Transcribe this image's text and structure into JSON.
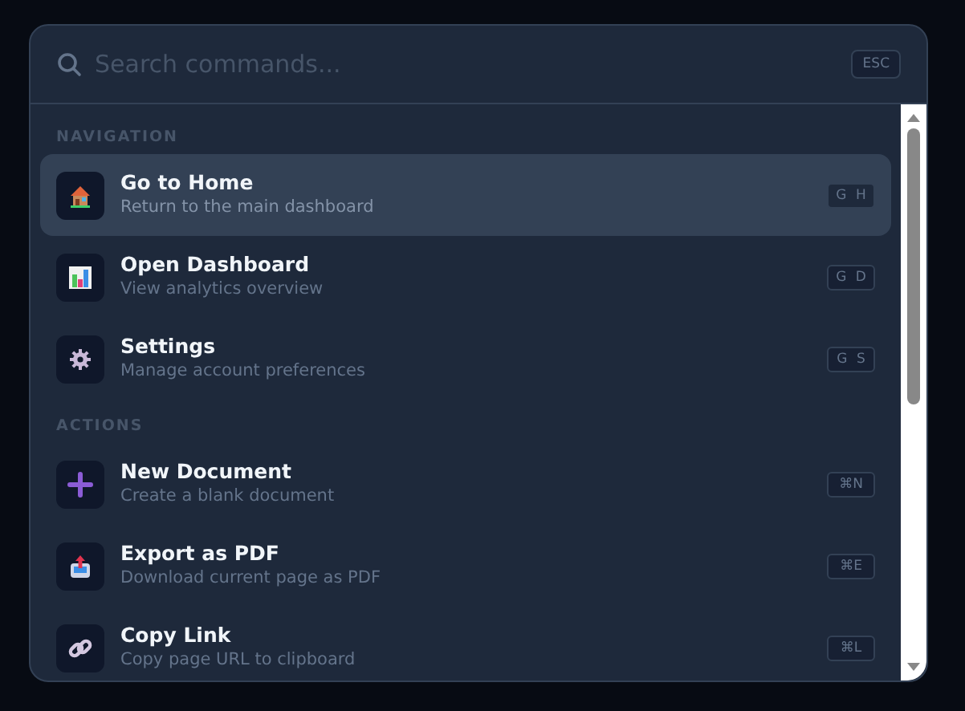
{
  "search": {
    "placeholder": "Search commands...",
    "shortcut": "ESC"
  },
  "groups": [
    {
      "label": "NAVIGATION",
      "items": [
        {
          "title": "Go to Home",
          "subtitle": "Return to the main dashboard",
          "shortcut": "G H",
          "selected": true
        },
        {
          "title": "Open Dashboard",
          "subtitle": "View analytics overview",
          "shortcut": "G D",
          "selected": false
        },
        {
          "title": "Settings",
          "subtitle": "Manage account preferences",
          "shortcut": "G S",
          "selected": false
        }
      ]
    },
    {
      "label": "ACTIONS",
      "items": [
        {
          "title": "New Document",
          "subtitle": "Create a blank document",
          "shortcut": "⌘N",
          "selected": false
        },
        {
          "title": "Export as PDF",
          "subtitle": "Download current page as PDF",
          "shortcut": "⌘E",
          "selected": false
        },
        {
          "title": "Copy Link",
          "subtitle": "Copy page URL to clipboard",
          "shortcut": "⌘L",
          "selected": false
        }
      ]
    }
  ]
}
